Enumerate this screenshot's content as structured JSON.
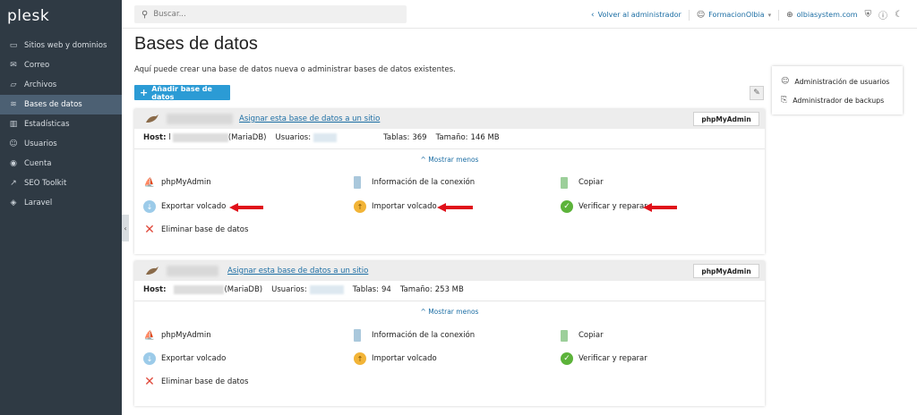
{
  "app": {
    "logo": "plesk"
  },
  "sidebar": {
    "items": [
      {
        "label": "Sitios web y dominios",
        "icon": "monitor-icon"
      },
      {
        "label": "Correo",
        "icon": "mail-icon"
      },
      {
        "label": "Archivos",
        "icon": "folder-icon"
      },
      {
        "label": "Bases de datos",
        "icon": "database-icon",
        "active": true
      },
      {
        "label": "Estadísticas",
        "icon": "chart-icon"
      },
      {
        "label": "Usuarios",
        "icon": "user-icon"
      },
      {
        "label": "Cuenta",
        "icon": "account-icon"
      },
      {
        "label": "SEO Toolkit",
        "icon": "seo-icon"
      },
      {
        "label": "Laravel",
        "icon": "laravel-icon"
      }
    ]
  },
  "topbar": {
    "search_placeholder": "Buscar...",
    "back_admin": "Volver al administrador",
    "user": "FormacionOlbia",
    "domain": "olbiasystem.com"
  },
  "main": {
    "title": "Bases de datos",
    "subtitle": "Aquí puede crear una base de datos nueva o administrar bases de datos existentes.",
    "add_button": "Añadir base de datos"
  },
  "right_panel": {
    "items": [
      {
        "label": "Administración de usuarios",
        "icon": "user-admin-icon"
      },
      {
        "label": "Administrador de backups",
        "icon": "backup-icon"
      }
    ]
  },
  "databases": [
    {
      "assign_link": "Asignar esta base de datos a un sitio",
      "phpmyadmin_button": "phpMyAdmin",
      "host_label": "Host:",
      "host_value": "l",
      "engine": "(MariaDB)",
      "users_label": "Usuarios:",
      "tables_label": "Tablas:",
      "tables_value": "369",
      "size_label": "Tamaño:",
      "size_value": "146 MB",
      "toggle": "^ Mostrar menos",
      "actions": {
        "phpmyadmin": "phpMyAdmin",
        "export": "Exportar volcado",
        "delete": "Eliminar base de datos",
        "connection": "Información de la conexión",
        "import": "Importar volcado",
        "copy": "Copiar",
        "check": "Verificar y reparar"
      }
    },
    {
      "assign_link": "Asignar esta base de datos a un sitio",
      "phpmyadmin_button": "phpMyAdmin",
      "host_label": "Host:",
      "host_value": "",
      "engine": "(MariaDB)",
      "users_label": "Usuarios:",
      "tables_label": "Tablas:",
      "tables_value": "94",
      "size_label": "Tamaño:",
      "size_value": "253 MB",
      "toggle": "^ Mostrar menos",
      "actions": {
        "phpmyadmin": "phpMyAdmin",
        "export": "Exportar volcado",
        "delete": "Eliminar base de datos",
        "connection": "Información de la conexión",
        "import": "Importar volcado",
        "copy": "Copiar",
        "check": "Verificar y reparar"
      }
    }
  ],
  "colors": {
    "sidebar_bg": "#2f3a44",
    "sidebar_active": "#4c6073",
    "accent": "#2b9bd5",
    "link": "#1c6ea4",
    "annotation_arrow": "#e0101a"
  }
}
